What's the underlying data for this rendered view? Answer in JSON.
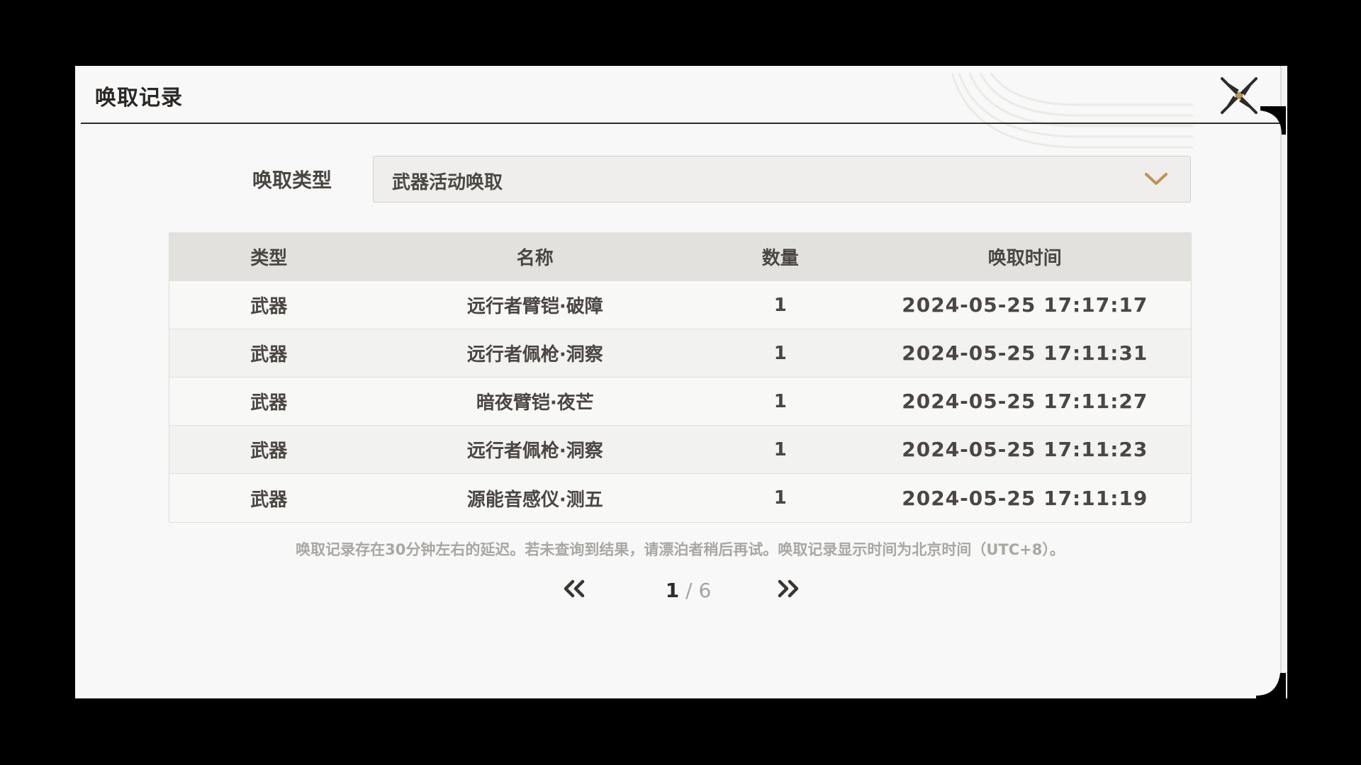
{
  "dialog": {
    "title": "唤取记录"
  },
  "filter": {
    "label": "唤取类型",
    "selected": "武器活动唤取"
  },
  "table": {
    "headers": [
      "类型",
      "名称",
      "数量",
      "唤取时间"
    ],
    "rows": [
      {
        "type": "武器",
        "name": "远行者臂铠·破障",
        "qty": "1",
        "time": "2024-05-25 17:17:17"
      },
      {
        "type": "武器",
        "name": "远行者佩枪·洞察",
        "qty": "1",
        "time": "2024-05-25 17:11:31"
      },
      {
        "type": "武器",
        "name": "暗夜臂铠·夜芒",
        "qty": "1",
        "time": "2024-05-25 17:11:27"
      },
      {
        "type": "武器",
        "name": "远行者佩枪·洞察",
        "qty": "1",
        "time": "2024-05-25 17:11:23"
      },
      {
        "type": "武器",
        "name": "源能音感仪·测五",
        "qty": "1",
        "time": "2024-05-25 17:11:19"
      }
    ]
  },
  "note": "唤取记录存在30分钟左右的延迟。若未查询到结果，请漂泊者稍后再试。唤取记录显示时间为北京时间（UTC+8）。",
  "pagination": {
    "current": "1",
    "separator": " / ",
    "total": "6"
  },
  "colors": {
    "accent_gold": "#b9945a",
    "text_dark": "#2a2725",
    "text_body": "#4b4642",
    "text_muted": "#aaa7a3",
    "panel_bg": "#f7f8f7",
    "header_row_bg": "#e3e1de"
  },
  "icons": {
    "close": "close-x-icon",
    "dropdown": "chevron-down-icon",
    "prev": "double-chevron-left-icon",
    "next": "double-chevron-right-icon"
  }
}
